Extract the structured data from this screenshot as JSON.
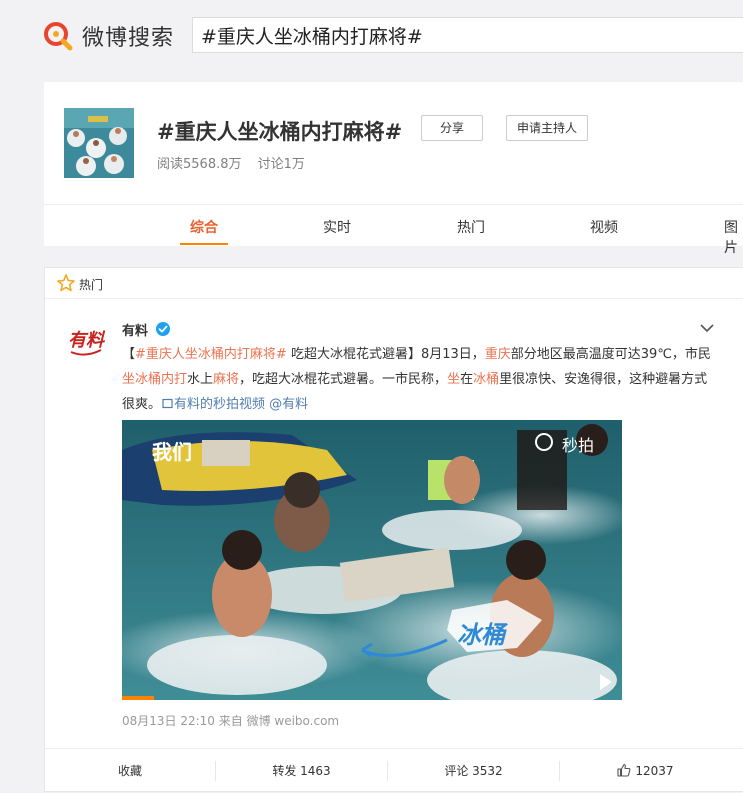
{
  "header": {
    "logo_text": "微博搜索",
    "search_value": "#重庆人坐冰桶内打麻将#"
  },
  "topic": {
    "title": "#重庆人坐冰桶内打麻将#",
    "share_label": "分享",
    "host_label": "申请主持人",
    "reads": "阅读5568.8万",
    "discussions": "讨论1万"
  },
  "tabs": [
    {
      "label": "综合",
      "active": true
    },
    {
      "label": "实时"
    },
    {
      "label": "热门"
    },
    {
      "label": "视频"
    },
    {
      "label": "图片"
    }
  ],
  "feed": {
    "section_label": "热门",
    "post": {
      "author": "有料",
      "avatar_text": "有料",
      "text": {
        "s1": "【",
        "s2": "#重庆人坐冰桶内打麻将#",
        "s3": " 吃超大冰棍花式避暑】8月13日，",
        "s4": "重庆",
        "s5": "部分地区最高温度可达39℃，市民",
        "s6": "坐冰桶内打",
        "s7": "水上",
        "s8": "麻将",
        "s9": "，吃超大冰棍花式避暑。一市民称，",
        "s10": "坐",
        "s11": "在",
        "s12": "冰桶",
        "s13": "里很凉快、安逸得很，这种避暑方式很爽。",
        "link1": "有料的秒拍视频",
        "link2": " @有料"
      },
      "image_overlay": {
        "brand": "我们",
        "watermark": "秒拍",
        "caption": "冰桶"
      },
      "timestamp": "08月13日 22:10",
      "source": "来自 微博 weibo.com",
      "actions": {
        "favorite": "收藏",
        "repost": "转发 1463",
        "comment": "评论 3532",
        "like": "12037"
      }
    }
  },
  "colors": {
    "accent": "#ff8200",
    "tab_active": "#e8632f",
    "highlight": "#eb7350",
    "link": "#507daf",
    "verified": "#1da1f2",
    "logo_red": "#e8442e"
  }
}
